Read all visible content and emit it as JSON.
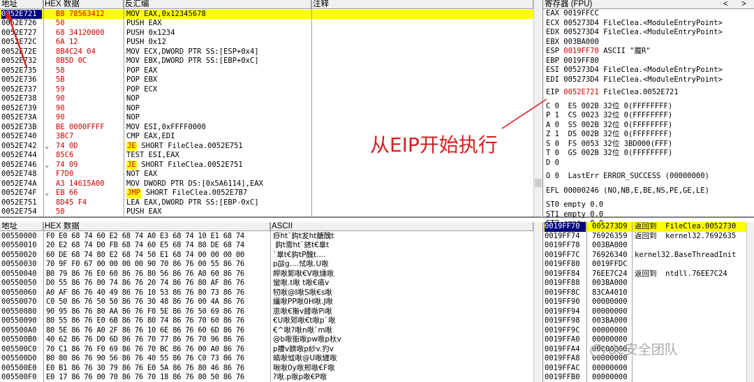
{
  "disasm": {
    "col_addr": "地址",
    "col_hex": "HEX 数据",
    "col_asm": "反汇编",
    "col_comment": "注释",
    "rows": [
      {
        "addr": "0052E721",
        "jmp": "",
        "hex": "B8 78563412",
        "asm": "MOV EAX,0x12345678",
        "hl": ""
      },
      {
        "addr": "0052E726",
        "jmp": "",
        "hex": "50",
        "asm": "PUSH EAX",
        "hl": ""
      },
      {
        "addr": "0052E727",
        "jmp": "",
        "hex": "68 34120000",
        "asm": "PUSH 0x1234",
        "hl": ""
      },
      {
        "addr": "0052E72C",
        "jmp": "",
        "hex": "6A 12",
        "asm": "PUSH 0x12",
        "hl": ""
      },
      {
        "addr": "0052E72E",
        "jmp": "",
        "hex": "8B4C24 04",
        "asm": "MOV ECX,DWORD PTR SS:[ESP+0x4]",
        "hl": ""
      },
      {
        "addr": "0052E732",
        "jmp": "",
        "hex": "8B5D 0C",
        "asm": "MOV EBX,DWORD PTR SS:[EBP+0xC]",
        "hl": ""
      },
      {
        "addr": "0052E735",
        "jmp": "",
        "hex": "58",
        "asm": "POP EAX",
        "hl": ""
      },
      {
        "addr": "0052E736",
        "jmp": "",
        "hex": "5B",
        "asm": "POP EBX",
        "hl": ""
      },
      {
        "addr": "0052E737",
        "jmp": "",
        "hex": "59",
        "asm": "POP ECX",
        "hl": ""
      },
      {
        "addr": "0052E738",
        "jmp": "",
        "hex": "90",
        "asm": "NOP",
        "hl": ""
      },
      {
        "addr": "0052E739",
        "jmp": "",
        "hex": "90",
        "asm": "NOP",
        "hl": ""
      },
      {
        "addr": "0052E73A",
        "jmp": "",
        "hex": "90",
        "asm": "NOP",
        "hl": ""
      },
      {
        "addr": "0052E73B",
        "jmp": "",
        "hex": "BE 0000FFFF",
        "asm": "MOV ESI,0xFFFF0000",
        "hl": ""
      },
      {
        "addr": "0052E740",
        "jmp": "",
        "hex": "3BC7",
        "asm": "CMP EAX,EDI",
        "hl": ""
      },
      {
        "addr": "0052E742",
        "jmp": "⌄",
        "hex": "74 0D",
        "asm_op": "JE",
        "asm_rest": " SHORT FileClea.0052E751",
        "hl": "jmp"
      },
      {
        "addr": "0052E744",
        "jmp": "",
        "hex": "85C6",
        "asm": "TEST ESI,EAX",
        "hl": ""
      },
      {
        "addr": "0052E746",
        "jmp": "⌄",
        "hex": "74 09",
        "asm_op": "JE",
        "asm_rest": " SHORT FileClea.0052E751",
        "hl": "jmp"
      },
      {
        "addr": "0052E748",
        "jmp": "",
        "hex": "F7D0",
        "asm": "NOT EAX",
        "hl": ""
      },
      {
        "addr": "0052E74A",
        "jmp": "",
        "hex": "A3 14615A00",
        "asm": "MOV DWORD PTR DS:[0x5A6114],EAX",
        "hl": ""
      },
      {
        "addr": "0052E74F",
        "jmp": "⌄",
        "hex": "EB 66",
        "asm_op": "JMP",
        "asm_rest": " SHORT FileClea.0052E7B7",
        "hl": "jmp"
      },
      {
        "addr": "0052E751",
        "jmp": "",
        "hex": "8D45 F4",
        "asm": "LEA EAX,DWORD PTR SS:[EBP-0xC]",
        "hl": ""
      },
      {
        "addr": "0052E754",
        "jmp": "",
        "hex": "50",
        "asm": "PUSH EAX",
        "hl": ""
      }
    ]
  },
  "registers": {
    "title": "寄存器 (FPU)",
    "lines1": [
      {
        "name": "EAX",
        "val": "0019FFCC",
        "info": "",
        "red": false
      },
      {
        "name": "ECX",
        "val": "005273D4",
        "info": "FileClea.<ModuleEntryPoint>",
        "red": false
      },
      {
        "name": "EDX",
        "val": "005273D4",
        "info": "FileClea.<ModuleEntryPoint>",
        "red": false
      },
      {
        "name": "EBX",
        "val": "003BA000",
        "info": "",
        "red": false
      },
      {
        "name": "ESP",
        "val": "0019FF70",
        "info": "ASCII \"龎R\"",
        "red": true
      },
      {
        "name": "EBP",
        "val": "0019FF80",
        "info": "",
        "red": false
      },
      {
        "name": "ESI",
        "val": "005273D4",
        "info": "FileClea.<ModuleEntryPoint>",
        "red": false
      },
      {
        "name": "EDI",
        "val": "005273D4",
        "info": "FileClea.<ModuleEntryPoint>",
        "red": false
      }
    ],
    "eip": {
      "name": "EIP",
      "val": "0052E721",
      "info": "FileClea.0052E721"
    },
    "flags": [
      "C 0  ES 002B 32位 0(FFFFFFFF)",
      "P 1  CS 0023 32位 0(FFFFFFFF)",
      "A 0  SS 002B 32位 0(FFFFFFFF)",
      "Z 1  DS 002B 32位 0(FFFFFFFF)",
      "S 0  FS 0053 32位 3BD000(FFF)",
      "T 0  GS 002B 32位 0(FFFFFFFF)",
      "D 0",
      "O 0  LastErr ERROR_SUCCESS (00000000)"
    ],
    "efl": "EFL 00000246 (NO,NB,E,BE,NS,PE,GE,LE)",
    "fpu": [
      "ST0 empty 0.0",
      "ST1 empty 0.0",
      "ST2 empty 0.0"
    ]
  },
  "annotation": "从EIP开始执行",
  "dump": {
    "col_addr": "地址",
    "col_hex": "HEX 数据",
    "col_ascii": "ASCII",
    "rows": [
      {
        "addr": "00550000",
        "hex": "F0 E0 68 74 60 E2 68 74 A0 E3 68 74 10 E1 68 74",
        "ascii": "痧ht`鈎t犮ht餹醜t"
      },
      {
        "addr": "00550010",
        "hex": "20 E2 68 74 D0 FB 68 74 60 E5 68 74 80 DE 68 74",
        "ascii": " 鈎t需ht`錰t€辠t"
      },
      {
        "addr": "00550020",
        "hex": "60 DE 68 74 80 E2 68 74 50 E1 68 74 00 00 00 00",
        "ascii": "`辠t€鈎tP醜t...."
      },
      {
        "addr": "00550030",
        "hex": "70 9F F0 67 00 00 00 00 90 70 86 76 00 55 86 76",
        "ascii": "p燄g....恜唙.U唙"
      },
      {
        "addr": "00550040",
        "hex": "B0 79 86 76 E0 60 86 76 80 56 86 76 A0 60 86 76",
        "ascii": "皔唙郹唙€V唙燻唙"
      },
      {
        "addr": "00550050",
        "hex": "D0 55 86 76 00 74 86 76 20 74 86 76 80 AF 86 76",
        "ascii": "蠻唙.t唙 t唙€瘑v"
      },
      {
        "addr": "00550060",
        "hex": "A0 AF 86 76 40 49 86 76 10 53 86 76 80 73 86 76",
        "ascii": "牣唙@I唙S唙€s唙"
      },
      {
        "addr": "00550070",
        "hex": "C0 50 86 76 50 50 86 76 30 48 86 76 00 4A 86 76",
        "ascii": "繮唙PP唙0H唙.J唙"
      },
      {
        "addr": "00550080",
        "hex": "90 95 86 76 80 AA 86 76 F0 5E 86 76 50 69 86 76",
        "ascii": "悤唙€獑v餧唙Pi唙"
      },
      {
        "addr": "00550090",
        "hex": "80 55 86 76 E0 6B 86 76 80 74 86 76 70 60 86 76",
        "ascii": "€U唙鄈唙€t唙p`唙"
      },
      {
        "addr": "005500A0",
        "hex": "80 5E 86 76 A0 2F 86 76 10 6E 86 76 60 6D 86 76",
        "ascii": "€^唙?唙n唙`m唙"
      },
      {
        "addr": "005500B0",
        "hex": "40 62 86 76 D0 6D 86 76 70 77 86 76 70 96 86 76",
        "ascii": "@b唙衜唙pw唙p杕v"
      },
      {
        "addr": "005500C0",
        "hex": "70 C1 86 76 F0 69 86 76 70 BC 86 76 00 A0 86 76",
        "ascii": "p羻v餴唙p紗v.犳v"
      },
      {
        "addr": "005500D0",
        "hex": "B0 80 86 76 90 56 86 76 40 55 86 76 C0 73 86 76",
        "ascii": "皜唙怴唙@U唙纒唙"
      },
      {
        "addr": "005500E0",
        "hex": "E0 B1 86 76 30 79 86 76 E0 5A 86 76 80 46 86 76",
        "ascii": "啾唙0y唙郱唙€F唙"
      },
      {
        "addr": "005500F0",
        "hex": "E0 17 86 76 00 70 86 76 70 18 86 76 80 50 86 76",
        "ascii": "?唙.p唙p唙€P唙"
      }
    ]
  },
  "stack": {
    "rows": [
      {
        "addr": "0019FF70",
        "val": "005273D9",
        "info": "返回到  FileClea.0052730",
        "sel": true
      },
      {
        "addr": "0019FF74",
        "val": "76926359",
        "info": "返回到  kernel32.7692635",
        "sel": false
      },
      {
        "addr": "0019FF78",
        "val": "003BA000",
        "info": "",
        "sel": false
      },
      {
        "addr": "0019FF7C",
        "val": "76926340",
        "info": "kernel32.BaseThreadInit",
        "sel": false
      },
      {
        "addr": "0019FF80",
        "val": "0019FFDC",
        "info": "",
        "sel": false
      },
      {
        "addr": "0019FF84",
        "val": "76EE7C24",
        "info": "返回到  ntdll.76EE7C24",
        "sel": false
      },
      {
        "addr": "0019FF88",
        "val": "003BA000",
        "info": "",
        "sel": false
      },
      {
        "addr": "0019FF8C",
        "val": "83CA4010",
        "info": "",
        "sel": false
      },
      {
        "addr": "0019FF90",
        "val": "00000000",
        "info": "",
        "sel": false
      },
      {
        "addr": "0019FF94",
        "val": "00000000",
        "info": "",
        "sel": false
      },
      {
        "addr": "0019FF98",
        "val": "003BA000",
        "info": "",
        "sel": false
      },
      {
        "addr": "0019FF9C",
        "val": "00000000",
        "info": "",
        "sel": false
      },
      {
        "addr": "0019FFA0",
        "val": "00000000",
        "info": "",
        "sel": false
      },
      {
        "addr": "0019FFA4",
        "val": "00000000",
        "info": "",
        "sel": false
      },
      {
        "addr": "0019FFA8",
        "val": "00000000",
        "info": "",
        "sel": false
      },
      {
        "addr": "0019FFAC",
        "val": "00000000",
        "info": "",
        "sel": false
      },
      {
        "addr": "0019FFB0",
        "val": "00000000",
        "info": "",
        "sel": false
      }
    ]
  },
  "watermark": "de安全团队",
  "colors": {
    "highlight": "#ffff00",
    "selection": "#000080",
    "accent_red": "#d00000",
    "annotation_red": "#d81e1e"
  }
}
